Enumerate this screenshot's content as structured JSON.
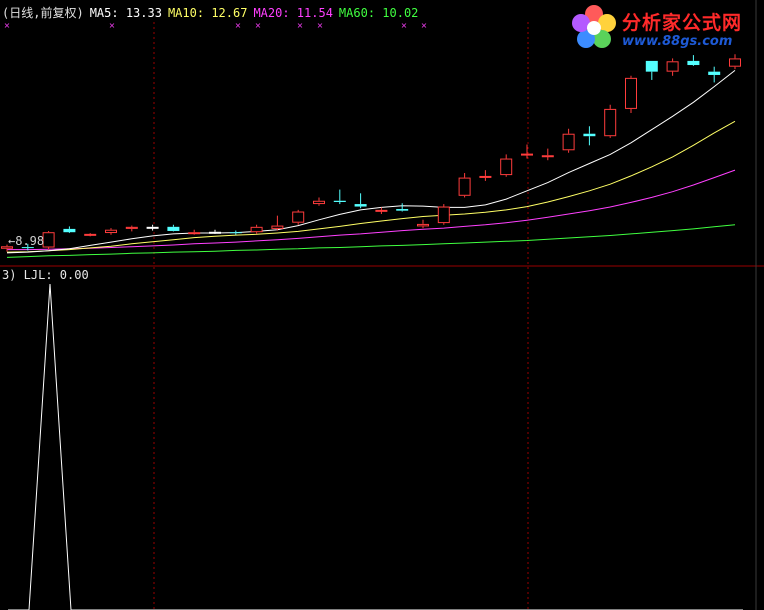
{
  "colors": {
    "background": "#000000",
    "up_candle": "#ff3c3c",
    "down_candle": "#54ffff",
    "doji": "#ffffff",
    "ma5": "#ffffff",
    "ma10": "#ffff66",
    "ma20": "#ff40ff",
    "ma60": "#40ff40",
    "separator": "#9a0000",
    "grid": "#9a0000",
    "indicator": "#ffffff"
  },
  "header": {
    "period": "(日线,前复权)",
    "ma5_label": "MA5:",
    "ma5_value": "13.33",
    "ma10_label": "MA10:",
    "ma10_value": "12.67",
    "ma20_label": "MA20:",
    "ma20_value": "11.54",
    "ma60_label": "MA60:",
    "ma60_value": "10.02"
  },
  "low_marker": "←8.98",
  "indicator_header": "3) LJL: 0.00",
  "logo": {
    "name": "分析家公式网",
    "url": "www.88gs.com",
    "icon": "flower-logo-icon"
  },
  "chart_data": [
    {
      "type": "candlestick",
      "ylim": [
        8.7,
        14.5
      ],
      "candles": [
        {
          "o": 9.02,
          "h": 9.12,
          "l": 8.95,
          "c": 9.08
        },
        {
          "o": 9.06,
          "h": 9.14,
          "l": 8.98,
          "c": 9.04
        },
        {
          "o": 9.05,
          "h": 9.45,
          "l": 9.0,
          "c": 9.42
        },
        {
          "o": 9.5,
          "h": 9.56,
          "l": 9.4,
          "c": 9.42
        },
        {
          "o": 9.34,
          "h": 9.4,
          "l": 9.32,
          "c": 9.38
        },
        {
          "o": 9.4,
          "h": 9.52,
          "l": 9.36,
          "c": 9.48
        },
        {
          "o": 9.5,
          "h": 9.58,
          "l": 9.44,
          "c": 9.55
        },
        {
          "o": 9.54,
          "h": 9.6,
          "l": 9.46,
          "c": 9.55
        },
        {
          "o": 9.55,
          "h": 9.6,
          "l": 9.44,
          "c": 9.45
        },
        {
          "o": 9.4,
          "h": 9.48,
          "l": 9.36,
          "c": 9.42
        },
        {
          "o": 9.42,
          "h": 9.48,
          "l": 9.38,
          "c": 9.43
        },
        {
          "o": 9.42,
          "h": 9.46,
          "l": 9.36,
          "c": 9.4
        },
        {
          "o": 9.42,
          "h": 9.6,
          "l": 9.38,
          "c": 9.55
        },
        {
          "o": 9.5,
          "h": 9.82,
          "l": 9.46,
          "c": 9.58
        },
        {
          "o": 9.65,
          "h": 9.96,
          "l": 9.6,
          "c": 9.92
        },
        {
          "o": 10.1,
          "h": 10.26,
          "l": 10.06,
          "c": 10.18
        },
        {
          "o": 10.18,
          "h": 10.45,
          "l": 10.1,
          "c": 10.15
        },
        {
          "o": 10.1,
          "h": 10.36,
          "l": 10.0,
          "c": 10.04
        },
        {
          "o": 9.92,
          "h": 10.02,
          "l": 9.86,
          "c": 9.96
        },
        {
          "o": 9.98,
          "h": 10.12,
          "l": 9.92,
          "c": 9.94
        },
        {
          "o": 9.56,
          "h": 9.72,
          "l": 9.52,
          "c": 9.62
        },
        {
          "o": 9.64,
          "h": 10.1,
          "l": 9.6,
          "c": 10.04
        },
        {
          "o": 10.3,
          "h": 10.85,
          "l": 10.26,
          "c": 10.74
        },
        {
          "o": 10.76,
          "h": 10.92,
          "l": 10.66,
          "c": 10.78
        },
        {
          "o": 10.8,
          "h": 11.3,
          "l": 10.76,
          "c": 11.2
        },
        {
          "o": 11.28,
          "h": 11.54,
          "l": 11.2,
          "c": 11.32
        },
        {
          "o": 11.24,
          "h": 11.44,
          "l": 11.16,
          "c": 11.28
        },
        {
          "o": 11.4,
          "h": 11.92,
          "l": 11.34,
          "c": 11.8
        },
        {
          "o": 11.8,
          "h": 11.98,
          "l": 11.52,
          "c": 11.74
        },
        {
          "o": 11.74,
          "h": 12.5,
          "l": 11.7,
          "c": 12.4
        },
        {
          "o": 12.4,
          "h": 13.2,
          "l": 12.3,
          "c": 13.15
        },
        {
          "o": 13.56,
          "h": 13.56,
          "l": 13.1,
          "c": 13.3
        },
        {
          "o": 13.3,
          "h": 13.62,
          "l": 13.2,
          "c": 13.55
        },
        {
          "o": 13.56,
          "h": 13.7,
          "l": 13.44,
          "c": 13.46
        },
        {
          "o": 13.3,
          "h": 13.42,
          "l": 13.04,
          "c": 13.22
        },
        {
          "o": 13.42,
          "h": 13.72,
          "l": 13.36,
          "c": 13.62
        }
      ],
      "ma5": [
        8.92,
        8.94,
        8.97,
        9.02,
        9.1,
        9.18,
        9.26,
        9.33,
        9.38,
        9.4,
        9.4,
        9.41,
        9.44,
        9.48,
        9.58,
        9.72,
        9.85,
        9.96,
        10.02,
        10.06,
        10.05,
        10.02,
        10.02,
        10.08,
        10.22,
        10.42,
        10.62,
        10.86,
        11.08,
        11.3,
        11.58,
        11.9,
        12.22,
        12.56,
        12.94,
        13.33
      ],
      "ma10": [
        8.94,
        8.95,
        8.97,
        9.0,
        9.04,
        9.08,
        9.14,
        9.19,
        9.24,
        9.29,
        9.32,
        9.35,
        9.37,
        9.4,
        9.44,
        9.5,
        9.56,
        9.63,
        9.69,
        9.75,
        9.8,
        9.83,
        9.86,
        9.9,
        9.96,
        10.04,
        10.15,
        10.28,
        10.42,
        10.58,
        10.78,
        11.0,
        11.24,
        11.52,
        11.82,
        12.1
      ],
      "ma20": [
        9.0,
        9.0,
        9.01,
        9.02,
        9.03,
        9.05,
        9.07,
        9.09,
        9.11,
        9.14,
        9.16,
        9.18,
        9.21,
        9.24,
        9.27,
        9.31,
        9.35,
        9.38,
        9.42,
        9.46,
        9.49,
        9.52,
        9.56,
        9.6,
        9.65,
        9.71,
        9.78,
        9.86,
        9.94,
        10.03,
        10.14,
        10.26,
        10.4,
        10.56,
        10.74,
        10.92
      ],
      "ma60": [
        8.81,
        8.83,
        8.85,
        8.86,
        8.88,
        8.89,
        8.91,
        8.92,
        8.94,
        8.95,
        8.96,
        8.98,
        8.99,
        9.01,
        9.02,
        9.04,
        9.05,
        9.07,
        9.09,
        9.1,
        9.12,
        9.14,
        9.16,
        9.18,
        9.2,
        9.22,
        9.25,
        9.28,
        9.31,
        9.34,
        9.38,
        9.42,
        9.46,
        9.5,
        9.55,
        9.6
      ],
      "last_ma": {
        "ma5": 13.33,
        "ma10": 12.67,
        "ma20": 11.54,
        "ma60": 10.02
      }
    },
    {
      "type": "line",
      "name": "LJL",
      "ylim": [
        0,
        1
      ],
      "x": [
        0,
        1,
        2,
        3,
        4,
        5,
        6,
        7,
        8,
        9,
        10,
        11,
        12,
        13,
        14,
        15,
        16,
        17,
        18,
        19,
        20,
        21,
        22,
        23,
        24,
        25,
        26,
        27,
        28,
        29,
        30,
        31,
        32,
        33,
        34,
        35
      ],
      "values": [
        0,
        0,
        1,
        0,
        0,
        0,
        0,
        0,
        0,
        0,
        0,
        0,
        0,
        0,
        0,
        0,
        0,
        0,
        0,
        0,
        0,
        0,
        0,
        0,
        0,
        0,
        0,
        0,
        0,
        0,
        0,
        0,
        0,
        0,
        0,
        0
      ]
    }
  ]
}
